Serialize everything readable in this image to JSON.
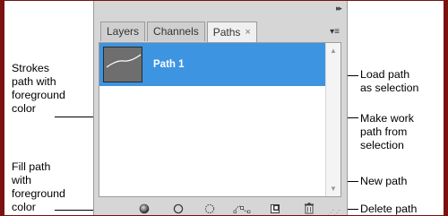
{
  "panel": {
    "tabs": [
      {
        "label": "Layers"
      },
      {
        "label": "Channels"
      },
      {
        "label": "Paths",
        "close": "×"
      }
    ],
    "collapse_glyph": "▸▸",
    "menu_glyph": "▾≡",
    "paths": [
      {
        "name": "Path 1"
      }
    ]
  },
  "annotations": {
    "strokes": "Strokes\npath with\nforeground\ncolor",
    "fill": "Fill path\nwith\nforeground\ncolor",
    "load": "Load path\nas selection",
    "work": "Make work\npath from\nselection",
    "new": "New path",
    "delete": "Delete path"
  },
  "colors": {
    "frame": "#7a1212",
    "selection": "#3d95e2",
    "panel_bg": "#d6d6d6"
  },
  "toolbar_icons": [
    "fill-path-icon",
    "stroke-path-icon",
    "load-selection-icon",
    "make-work-path-icon",
    "new-path-icon",
    "delete-path-icon"
  ]
}
